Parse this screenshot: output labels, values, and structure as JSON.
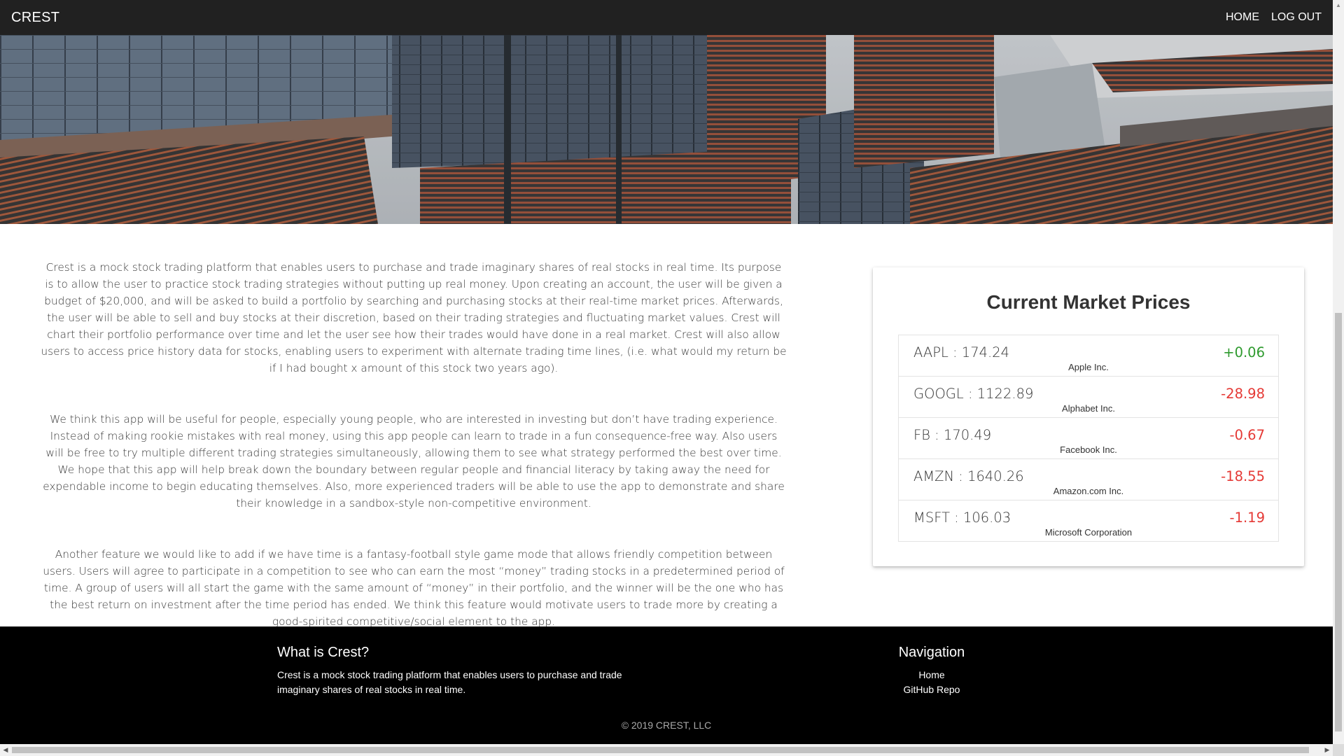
{
  "navbar": {
    "brand": "CREST",
    "links": [
      "HOME",
      "LOG OUT"
    ]
  },
  "hero": {
    "image": "office-building-facade-photo"
  },
  "about": {
    "paragraphs": [
      "Crest is a mock stock trading platform that enables users to purchase and trade imaginary shares of real stocks in real time. Its purpose is to allow the user to practice stock trading strategies without putting up real money. Upon creating an account, the user will be given a budget of $20,000, and will be asked to build a portfolio by searching and purchasing stocks at their real-time market prices. Afterwards, the user will be able to sell and buy stocks at their discretion, based on their trading strategies and fluctuating market values. Crest will chart their portfolio performance over time and let the user see how their trades would have done in a real market. Crest will also allow users to access price history data for stocks, enabling users to experiment with alternate trading time lines, (i.e. what would my return be if I had bought x amount of this stock two years ago).",
      "We think this app will be useful for people, especially young people, who are interested in investing but don’t have trading experience. Instead of making rookie mistakes with real money, using this app people can learn to trade in a fun consequence-free way. Also users will be free to try multiple different trading strategies simultaneously, allowing them to see what strategy performed the best over time. We hope that this app will help break down the boundary between regular people and financial literacy by taking away the need for expendable income to begin educating themselves. Also, more experienced traders will be able to use the app to demonstrate and share their knowledge in a sandbox-style non-competitive environment.",
      "Another feature we would like to add if we have time is a fantasy-football style game mode that allows friendly competition between users. Users will agree to participate in a competition to see who can earn the most “money” trading stocks in a predetermined period of time. A group of users will all start the game with the same amount of “money” in their portfolio, and the winner will be the one who has the best return on investment after the time period has ended. We think this feature would motivate users to trade more by creating a good-spirited competitive/social element to the app."
    ]
  },
  "market": {
    "title": "Current Market Prices",
    "colors": {
      "positive": "#2e9a2e",
      "negative": "#e53935"
    },
    "stocks": [
      {
        "label": "AAPL : 174.24",
        "change": "+0.06",
        "direction": "up",
        "company": "Apple Inc."
      },
      {
        "label": "GOOGL : 1122.89",
        "change": "-28.98",
        "direction": "down",
        "company": "Alphabet Inc."
      },
      {
        "label": "FB : 170.49",
        "change": "-0.67",
        "direction": "down",
        "company": "Facebook Inc."
      },
      {
        "label": "AMZN : 1640.26",
        "change": "-18.55",
        "direction": "down",
        "company": "Amazon.com Inc."
      },
      {
        "label": "MSFT : 106.03",
        "change": "-1.19",
        "direction": "down",
        "company": "Microsoft Corporation"
      }
    ]
  },
  "footer": {
    "about_heading": "What is Crest?",
    "about_text": "Crest is a mock stock trading platform that enables users to purchase and trade imaginary shares of real stocks in real time.",
    "nav_heading": "Navigation",
    "nav_links": [
      "Home",
      "GitHub Repo"
    ],
    "copyright": "© 2019 CREST, LLC"
  }
}
